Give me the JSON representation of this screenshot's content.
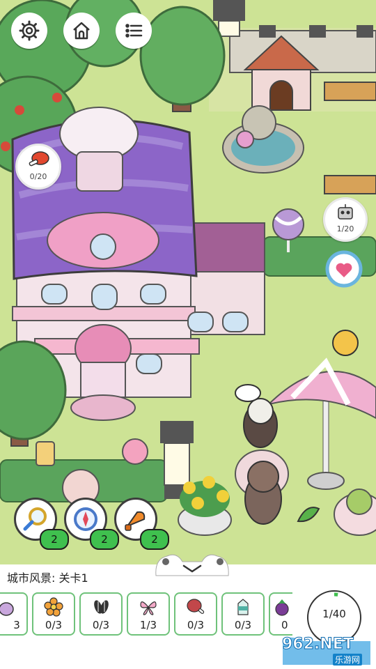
{
  "hud": {
    "settings_icon": "gear-icon",
    "home_icon": "house-icon",
    "menu_icon": "list-icon"
  },
  "bubbles": {
    "chicken": {
      "icon": "drumstick-icon",
      "count": "0/20"
    },
    "robot": {
      "icon": "robot-icon",
      "count": "1/20"
    }
  },
  "tools": [
    {
      "icon": "magnifier-icon",
      "count": "2"
    },
    {
      "icon": "compass-icon",
      "count": "2"
    },
    {
      "icon": "horn-icon",
      "count": "2"
    }
  ],
  "panel": {
    "level_title": "城市风景: 关卡1",
    "collapse_icon": "chevron-down-icon",
    "items": [
      {
        "icon": "onion-icon",
        "count": "3"
      },
      {
        "icon": "flower-icon",
        "count": "0/3"
      },
      {
        "icon": "sunflower-seed-icon",
        "count": "0/3"
      },
      {
        "icon": "butterfly-icon",
        "count": "1/3"
      },
      {
        "icon": "ham-icon",
        "count": "0/3"
      },
      {
        "icon": "milk-carton-icon",
        "count": "0/3"
      },
      {
        "icon": "eggplant-icon",
        "count": "0"
      }
    ],
    "progress": {
      "found": 1,
      "total": 40,
      "label": "1/40"
    }
  },
  "watermark": {
    "text": "962.NET",
    "sub": "乐游网"
  },
  "colors": {
    "green_accent": "#3fc04e",
    "slot_border": "#6fc27a",
    "roof_purple": "#8a63c9",
    "pink": "#e9a3c9"
  }
}
